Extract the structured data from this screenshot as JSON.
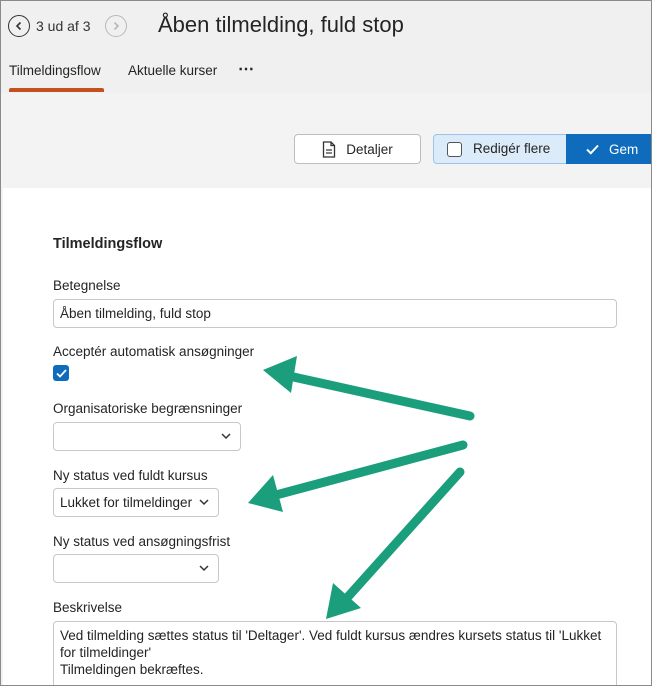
{
  "header": {
    "title": "Åben tilmelding, fuld stop",
    "counter": "3 ud af 3",
    "tabs": [
      {
        "label": "Tilmeldingsflow",
        "active": true
      },
      {
        "label": "Aktuelle kurser",
        "active": false
      }
    ],
    "more_label": "⋯"
  },
  "toolbar": {
    "details_label": "Detaljer",
    "edit_multiple_label": "Redigér flere",
    "save_label": "Gem"
  },
  "form": {
    "section_title": "Tilmeldingsflow",
    "name_label": "Betegnelse",
    "name_value": "Åben tilmelding, fuld stop",
    "auto_accept_label": "Acceptér automatisk ansøgninger",
    "auto_accept_checked": true,
    "org_restrictions_label": "Organisatoriske begrænsninger",
    "org_restrictions_value": "",
    "full_course_status_label": "Ny status ved fuldt kursus",
    "full_course_status_value": "Lukket for tilmeldinger",
    "deadline_status_label": "Ny status ved ansøgningsfrist",
    "deadline_status_value": "",
    "description_label": "Beskrivelse",
    "description_lines": [
      "Ved tilmelding sættes status til 'Deltager'. Ved fuldt kursus ændres kursets status til 'Lukket",
      "for tilmeldinger'",
      "Tilmeldingen bekræftes."
    ]
  },
  "colors": {
    "accent": "#0f6cbd",
    "tab_underline": "#c4501f",
    "annotation_arrow": "#1a9e7c"
  }
}
